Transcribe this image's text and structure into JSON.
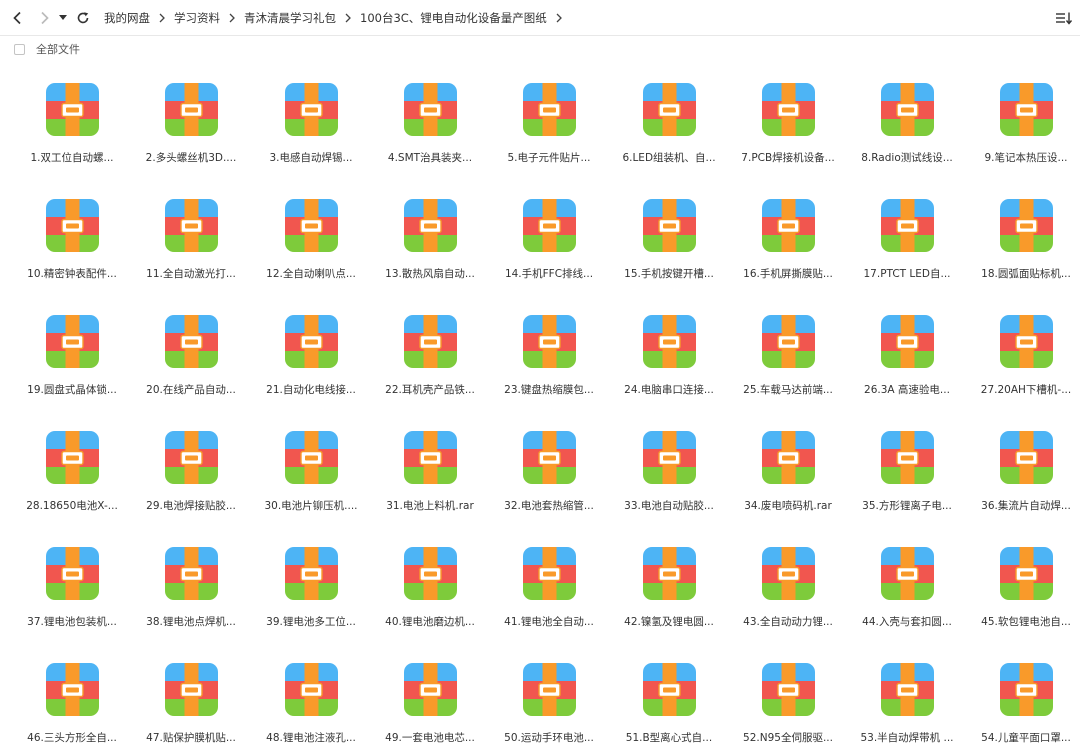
{
  "toolbar": {
    "back_icon": "chevron-left-icon",
    "forward_icon": "chevron-right-icon",
    "history_icon": "caret-down-icon",
    "refresh_icon": "refresh-icon",
    "sort_icon": "sort-list-icon",
    "breadcrumb": [
      "我的网盘",
      "学习资料",
      "青沐清晨学习礼包",
      "100台3C、锂电自动化设备量产图纸"
    ]
  },
  "subbar": {
    "select_all_label": "全部文件"
  },
  "colors": {
    "archive_top": "#4db4f5",
    "archive_middle": "#f1564f",
    "archive_bottom": "#7ecb3b",
    "archive_strap": "#f99a2a"
  },
  "files": [
    "1.双工位自动螺...",
    "2.多头螺丝机3D....",
    "3.电感自动焊锡...",
    "4.SMT治具装夹...",
    "5.电子元件贴片...",
    "6.LED组装机、自...",
    "7.PCB焊接机设备...",
    "8.Radio测试线设...",
    "9.笔记本热压设...",
    "10.精密钟表配件...",
    "11.全自动激光打...",
    "12.全自动喇叭点...",
    "13.散热风扇自动...",
    "14.手机FFC排线...",
    "15.手机按键开槽...",
    "16.手机屏撕膜贴...",
    "17.PTCT LED自...",
    "18.圆弧面贴标机...",
    "19.圆盘式晶体锁...",
    "20.在线产品自动...",
    "21.自动化电线接...",
    "22.耳机壳产品铁...",
    "23.键盘热缩膜包...",
    "24.电脑串口连接...",
    "25.车载马达前端...",
    "26.3A 高速验电...",
    "27.20AH下槽机-...",
    "28.18650电池X-...",
    "29.电池焊接贴胶...",
    "30.电池片铆压机....",
    "31.电池上料机.rar",
    "32.电池套热缩管...",
    "33.电池自动贴胶...",
    "34.废电喷码机.rar",
    "35.方形锂离子电...",
    "36.集流片自动焊...",
    "37.锂电池包装机...",
    "38.锂电池点焊机...",
    "39.锂电池多工位...",
    "40.锂电池磨边机...",
    "41.锂电池全自动...",
    "42.镍氢及锂电圆...",
    "43.全自动动力锂...",
    "44.入壳与套扣圆...",
    "45.软包锂电池自...",
    "46.三头方形全自...",
    "47.贴保护膜机贴...",
    "48.锂电池注液孔...",
    "49.一套电池电芯...",
    "50.运动手环电池...",
    "51.B型离心式自...",
    "52.N95全伺服驱...",
    "53.半自动焊带机 ...",
    "54.儿童平面口罩..."
  ]
}
